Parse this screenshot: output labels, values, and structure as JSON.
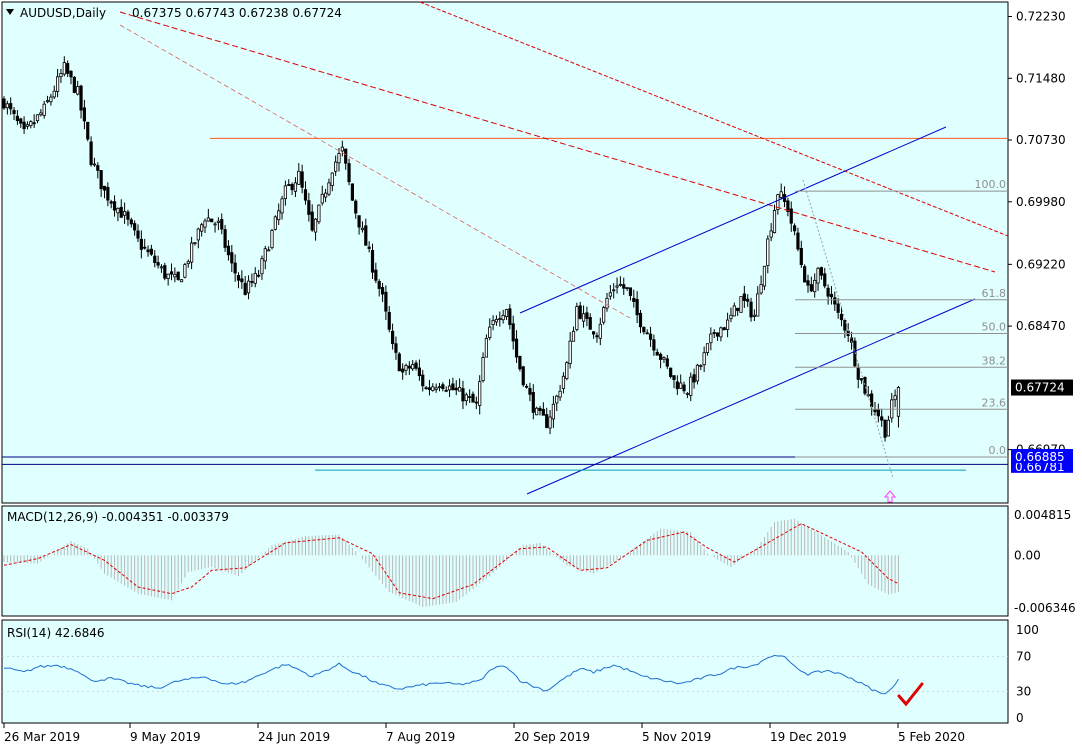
{
  "colors": {
    "background": "#e0ffff",
    "candle": "#000000",
    "channel": "#0000cc",
    "resistance": "#ff5a1f",
    "downtrend": "#dd0000",
    "fib": "#909090",
    "support_blue": "#000080",
    "support_cyan": "#00a0b0",
    "macd_hist": "#b8b8b8",
    "macd_signal": "#e00000",
    "rsi_line": "#1e6fd0",
    "price_tag_bg": "#000000",
    "support_tag_bg": "#0000ff",
    "check": "#e00000",
    "arrow": "#ff40ff"
  },
  "icons": {
    "check": "check-mark-icon",
    "arrow": "up-arrow-icon",
    "symbol_menu": "triangle-down-icon"
  },
  "chart_data": [
    {
      "type": "candlestick",
      "title": "AUDUSD,Daily",
      "ohlc_header": "0.67375 0.67743 0.67238 0.67724",
      "ylim": [
        0.6637,
        0.7237
      ],
      "yticks": [
        "0.72230",
        "0.71480",
        "0.70730",
        "0.69980",
        "0.69220",
        "0.68470",
        "0.67724",
        "0.66970",
        "0.66885",
        "0.66781"
      ],
      "current_price": "0.67724",
      "support_labels": [
        "0.66885",
        "0.66781"
      ],
      "xlabels": [
        "26 Mar 2019",
        "9 May 2019",
        "24 Jun 2019",
        "7 Aug 2019",
        "20 Sep 2019",
        "5 Nov 2019",
        "19 Dec 2019",
        "5 Feb 2020"
      ],
      "close_path": [
        [
          0,
          0.712
        ],
        [
          6,
          0.708
        ],
        [
          12,
          0.711
        ],
        [
          18,
          0.716
        ],
        [
          22,
          0.713
        ],
        [
          26,
          0.705
        ],
        [
          30,
          0.701
        ],
        [
          36,
          0.698
        ],
        [
          40,
          0.695
        ],
        [
          44,
          0.693
        ],
        [
          48,
          0.691
        ],
        [
          52,
          0.69
        ],
        [
          56,
          0.694
        ],
        [
          60,
          0.698
        ],
        [
          64,
          0.697
        ],
        [
          68,
          0.692
        ],
        [
          72,
          0.689
        ],
        [
          76,
          0.691
        ],
        [
          80,
          0.696
        ],
        [
          84,
          0.701
        ],
        [
          88,
          0.703
        ],
        [
          92,
          0.696
        ],
        [
          95,
          0.7
        ],
        [
          98,
          0.704
        ],
        [
          101,
          0.706
        ],
        [
          104,
          0.7
        ],
        [
          107,
          0.696
        ],
        [
          110,
          0.692
        ],
        [
          113,
          0.688
        ],
        [
          116,
          0.682
        ],
        [
          119,
          0.679
        ],
        [
          122,
          0.68
        ],
        [
          126,
          0.677
        ],
        [
          130,
          0.678
        ],
        [
          134,
          0.677
        ],
        [
          138,
          0.676
        ],
        [
          141,
          0.675
        ],
        [
          144,
          0.683
        ],
        [
          147,
          0.686
        ],
        [
          150,
          0.687
        ],
        [
          153,
          0.681
        ],
        [
          156,
          0.677
        ],
        [
          159,
          0.674
        ],
        [
          162,
          0.673
        ],
        [
          165,
          0.676
        ],
        [
          168,
          0.68
        ],
        [
          171,
          0.687
        ],
        [
          174,
          0.685
        ],
        [
          177,
          0.684
        ],
        [
          180,
          0.688
        ],
        [
          183,
          0.69
        ],
        [
          186,
          0.689
        ],
        [
          189,
          0.686
        ],
        [
          192,
          0.684
        ],
        [
          196,
          0.681
        ],
        [
          200,
          0.678
        ],
        [
          204,
          0.677
        ],
        [
          208,
          0.68
        ],
        [
          212,
          0.684
        ],
        [
          216,
          0.685
        ],
        [
          220,
          0.688
        ],
        [
          224,
          0.686
        ],
        [
          228,
          0.695
        ],
        [
          231,
          0.701
        ],
        [
          234,
          0.699
        ],
        [
          237,
          0.694
        ],
        [
          240,
          0.689
        ],
        [
          243,
          0.691
        ],
        [
          246,
          0.689
        ],
        [
          249,
          0.686
        ],
        [
          252,
          0.684
        ],
        [
          255,
          0.679
        ],
        [
          258,
          0.676
        ],
        [
          261,
          0.674
        ],
        [
          263,
          0.672
        ],
        [
          265,
          0.675
        ],
        [
          267,
          0.6772
        ]
      ],
      "resistance_level": 0.7075,
      "support_levels": [
        0.6688,
        0.6679,
        0.6672
      ],
      "fib_levels": [
        {
          "label": "100.0",
          "value": 0.7011
        },
        {
          "label": "61.8",
          "value": 0.6879
        },
        {
          "label": "50.0",
          "value": 0.6838
        },
        {
          "label": "38.2",
          "value": 0.6797
        },
        {
          "label": "23.6",
          "value": 0.6746
        },
        {
          "label": "0.0",
          "value": 0.6688
        }
      ]
    },
    {
      "type": "line",
      "title": "MACD(12,26,9) -0.004351 -0.003379",
      "ylim": [
        -0.0068,
        0.0052
      ],
      "yticks": [
        "0.004815",
        "0.00",
        "-0.006346"
      ],
      "histogram": [
        [
          0,
          -0.0008
        ],
        [
          10,
          -0.001
        ],
        [
          20,
          0.0017
        ],
        [
          25,
          0.0008
        ],
        [
          30,
          -0.0022
        ],
        [
          40,
          -0.0046
        ],
        [
          50,
          -0.0054
        ],
        [
          55,
          -0.002
        ],
        [
          62,
          -0.0014
        ],
        [
          70,
          -0.0025
        ],
        [
          80,
          0.0012
        ],
        [
          90,
          0.0023
        ],
        [
          100,
          0.0025
        ],
        [
          105,
          0.0005
        ],
        [
          115,
          -0.0044
        ],
        [
          125,
          -0.0062
        ],
        [
          135,
          -0.0056
        ],
        [
          145,
          -0.0025
        ],
        [
          155,
          0.0012
        ],
        [
          160,
          0.0015
        ],
        [
          168,
          -0.0012
        ],
        [
          176,
          -0.0022
        ],
        [
          185,
          -0.0001
        ],
        [
          196,
          0.0032
        ],
        [
          205,
          0.0028
        ],
        [
          210,
          0.0002
        ],
        [
          217,
          -0.0014
        ],
        [
          225,
          0.001
        ],
        [
          230,
          0.004
        ],
        [
          236,
          0.0044
        ],
        [
          244,
          0.0024
        ],
        [
          252,
          0.0004
        ],
        [
          258,
          -0.0035
        ],
        [
          264,
          -0.0047
        ],
        [
          267,
          -0.0044
        ]
      ],
      "signal": [
        [
          0,
          -0.0012
        ],
        [
          10,
          -0.0004
        ],
        [
          20,
          0.0013
        ],
        [
          30,
          -0.0006
        ],
        [
          40,
          -0.0038
        ],
        [
          50,
          -0.0046
        ],
        [
          56,
          -0.0038
        ],
        [
          62,
          -0.0018
        ],
        [
          72,
          -0.0015
        ],
        [
          84,
          0.0015
        ],
        [
          100,
          0.0021
        ],
        [
          110,
          0.0002
        ],
        [
          118,
          -0.0045
        ],
        [
          128,
          -0.0052
        ],
        [
          140,
          -0.0035
        ],
        [
          154,
          0.0008
        ],
        [
          162,
          0.001
        ],
        [
          172,
          -0.0018
        ],
        [
          180,
          -0.0015
        ],
        [
          192,
          0.0018
        ],
        [
          203,
          0.0028
        ],
        [
          210,
          0.0009
        ],
        [
          218,
          -0.0008
        ],
        [
          228,
          0.0015
        ],
        [
          238,
          0.0038
        ],
        [
          246,
          0.0023
        ],
        [
          256,
          0.0004
        ],
        [
          264,
          -0.0028
        ],
        [
          267,
          -0.0034
        ]
      ]
    },
    {
      "type": "line",
      "title": "RSI(14) 42.6846",
      "ylim": [
        0,
        100
      ],
      "yticks": [
        "100",
        "70",
        "30",
        "0"
      ],
      "values": [
        [
          0,
          57
        ],
        [
          6,
          52
        ],
        [
          10,
          58
        ],
        [
          16,
          60
        ],
        [
          22,
          54
        ],
        [
          26,
          42
        ],
        [
          32,
          45
        ],
        [
          40,
          37
        ],
        [
          46,
          34
        ],
        [
          52,
          42
        ],
        [
          60,
          47
        ],
        [
          66,
          38
        ],
        [
          72,
          41
        ],
        [
          78,
          52
        ],
        [
          84,
          61
        ],
        [
          88,
          55
        ],
        [
          92,
          47
        ],
        [
          96,
          54
        ],
        [
          100,
          61
        ],
        [
          104,
          53
        ],
        [
          108,
          46
        ],
        [
          112,
          38
        ],
        [
          118,
          33
        ],
        [
          124,
          37
        ],
        [
          130,
          40
        ],
        [
          136,
          38
        ],
        [
          142,
          42
        ],
        [
          146,
          57
        ],
        [
          150,
          59
        ],
        [
          154,
          43
        ],
        [
          158,
          36
        ],
        [
          162,
          31
        ],
        [
          166,
          42
        ],
        [
          172,
          56
        ],
        [
          176,
          52
        ],
        [
          182,
          60
        ],
        [
          186,
          55
        ],
        [
          190,
          48
        ],
        [
          196,
          43
        ],
        [
          202,
          39
        ],
        [
          208,
          45
        ],
        [
          214,
          51
        ],
        [
          218,
          57
        ],
        [
          224,
          60
        ],
        [
          228,
          69
        ],
        [
          232,
          72
        ],
        [
          236,
          58
        ],
        [
          240,
          50
        ],
        [
          246,
          54
        ],
        [
          252,
          47
        ],
        [
          258,
          35
        ],
        [
          262,
          27
        ],
        [
          265,
          33
        ],
        [
          267,
          43
        ]
      ]
    }
  ]
}
